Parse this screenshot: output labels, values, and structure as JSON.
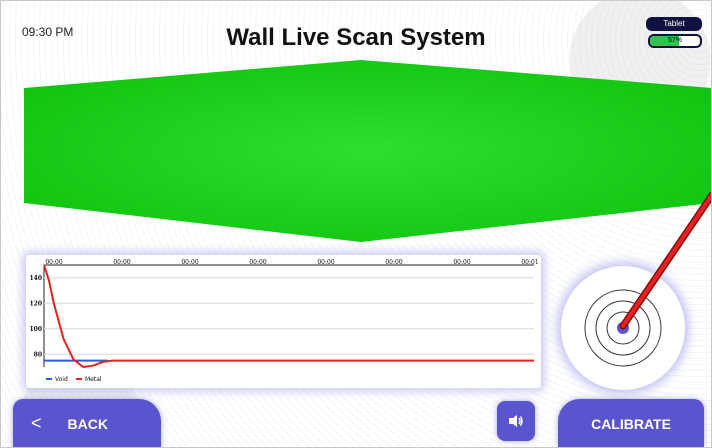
{
  "header": {
    "time": "09:30 PM",
    "title": "Wall Live Scan System",
    "device_label": "Tablet",
    "battery_text": "57%",
    "battery_level": 0.57
  },
  "scan": {
    "color": "#10c410"
  },
  "chart_data": {
    "type": "line",
    "x_tick_labels": [
      "00:00",
      "00:00",
      "00:00",
      "00:00",
      "00:00",
      "00:00",
      "00:00",
      "00:01"
    ],
    "y_ticks": [
      80,
      100,
      120,
      140
    ],
    "ylim": [
      70,
      150
    ],
    "legend": [
      {
        "name": "Void",
        "color": "#2f5be0"
      },
      {
        "name": "Metal",
        "color": "#e52121"
      }
    ],
    "series": [
      {
        "name": "Void",
        "x": [
          0,
          0.13
        ],
        "y": [
          75,
          75
        ]
      },
      {
        "name": "Metal",
        "x": [
          0,
          0.01,
          0.02,
          0.04,
          0.06,
          0.08,
          0.1,
          0.12,
          0.14,
          1.0
        ],
        "y": [
          150,
          138,
          120,
          92,
          76,
          70,
          71,
          74,
          75,
          75
        ]
      }
    ]
  },
  "buttons": {
    "back": "BACK",
    "calibrate": "CALIBRATE"
  },
  "icons": {
    "back": "chevron-left-icon",
    "sound": "speaker-icon"
  }
}
